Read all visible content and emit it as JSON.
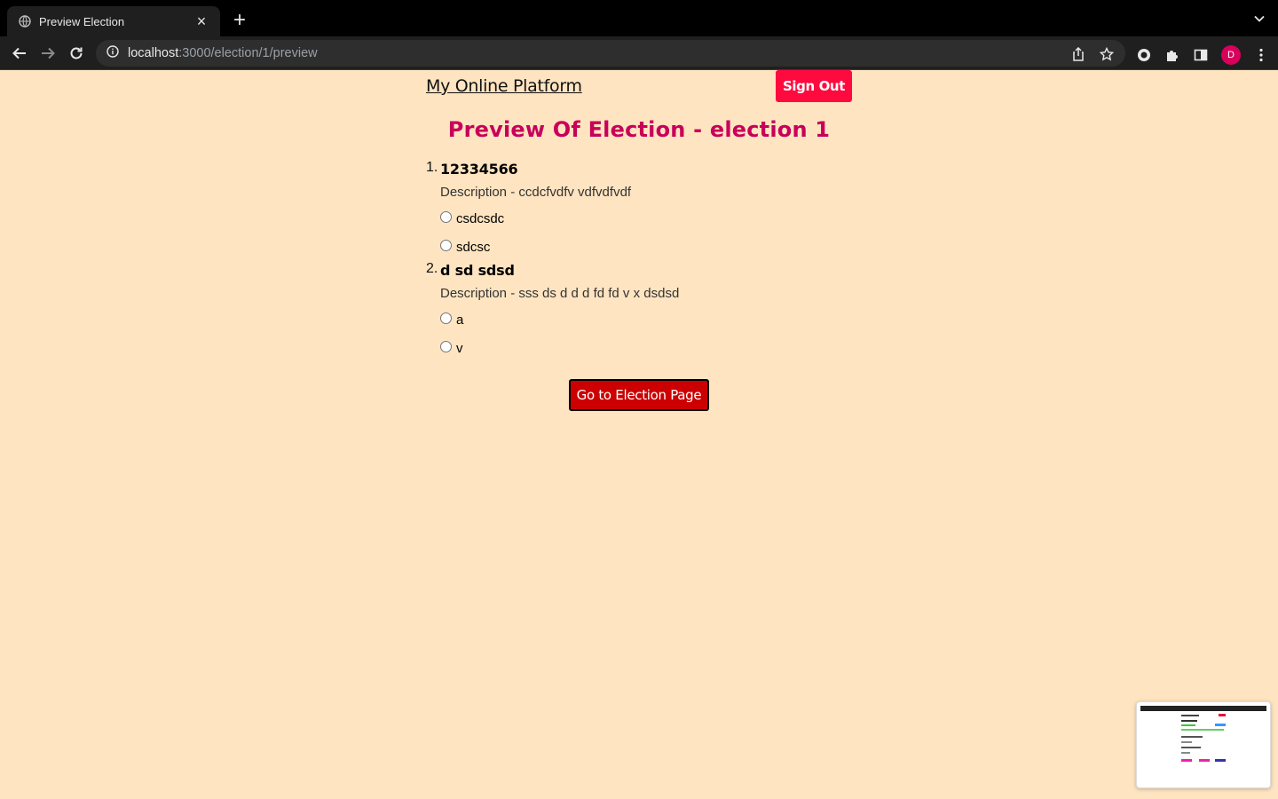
{
  "browser": {
    "tab_title": "Preview Election",
    "url_host": "localhost",
    "url_path": ":3000/election/1/preview",
    "profile_initial": "D"
  },
  "header": {
    "brand": "My Online Platform",
    "signout_label": "Sign Out"
  },
  "heading": "Preview Of Election - election 1",
  "questions": [
    {
      "number": "1.",
      "title": "12334566",
      "description": "Description - ccdcfvdfv vdfvdfvdf",
      "options": [
        "csdcsdc",
        "sdcsc"
      ]
    },
    {
      "number": "2.",
      "title": "d sd sdsd",
      "description": "Description - sss ds d d d fd fd v x dsdsd",
      "options": [
        "a",
        "v"
      ]
    }
  ],
  "go_button_label": "Go to Election Page",
  "colors": {
    "page_bg": "#ffe4c1",
    "heading": "#c8005a",
    "signout_bg": "#ff0a3e",
    "go_button_bg": "#cc0000"
  }
}
